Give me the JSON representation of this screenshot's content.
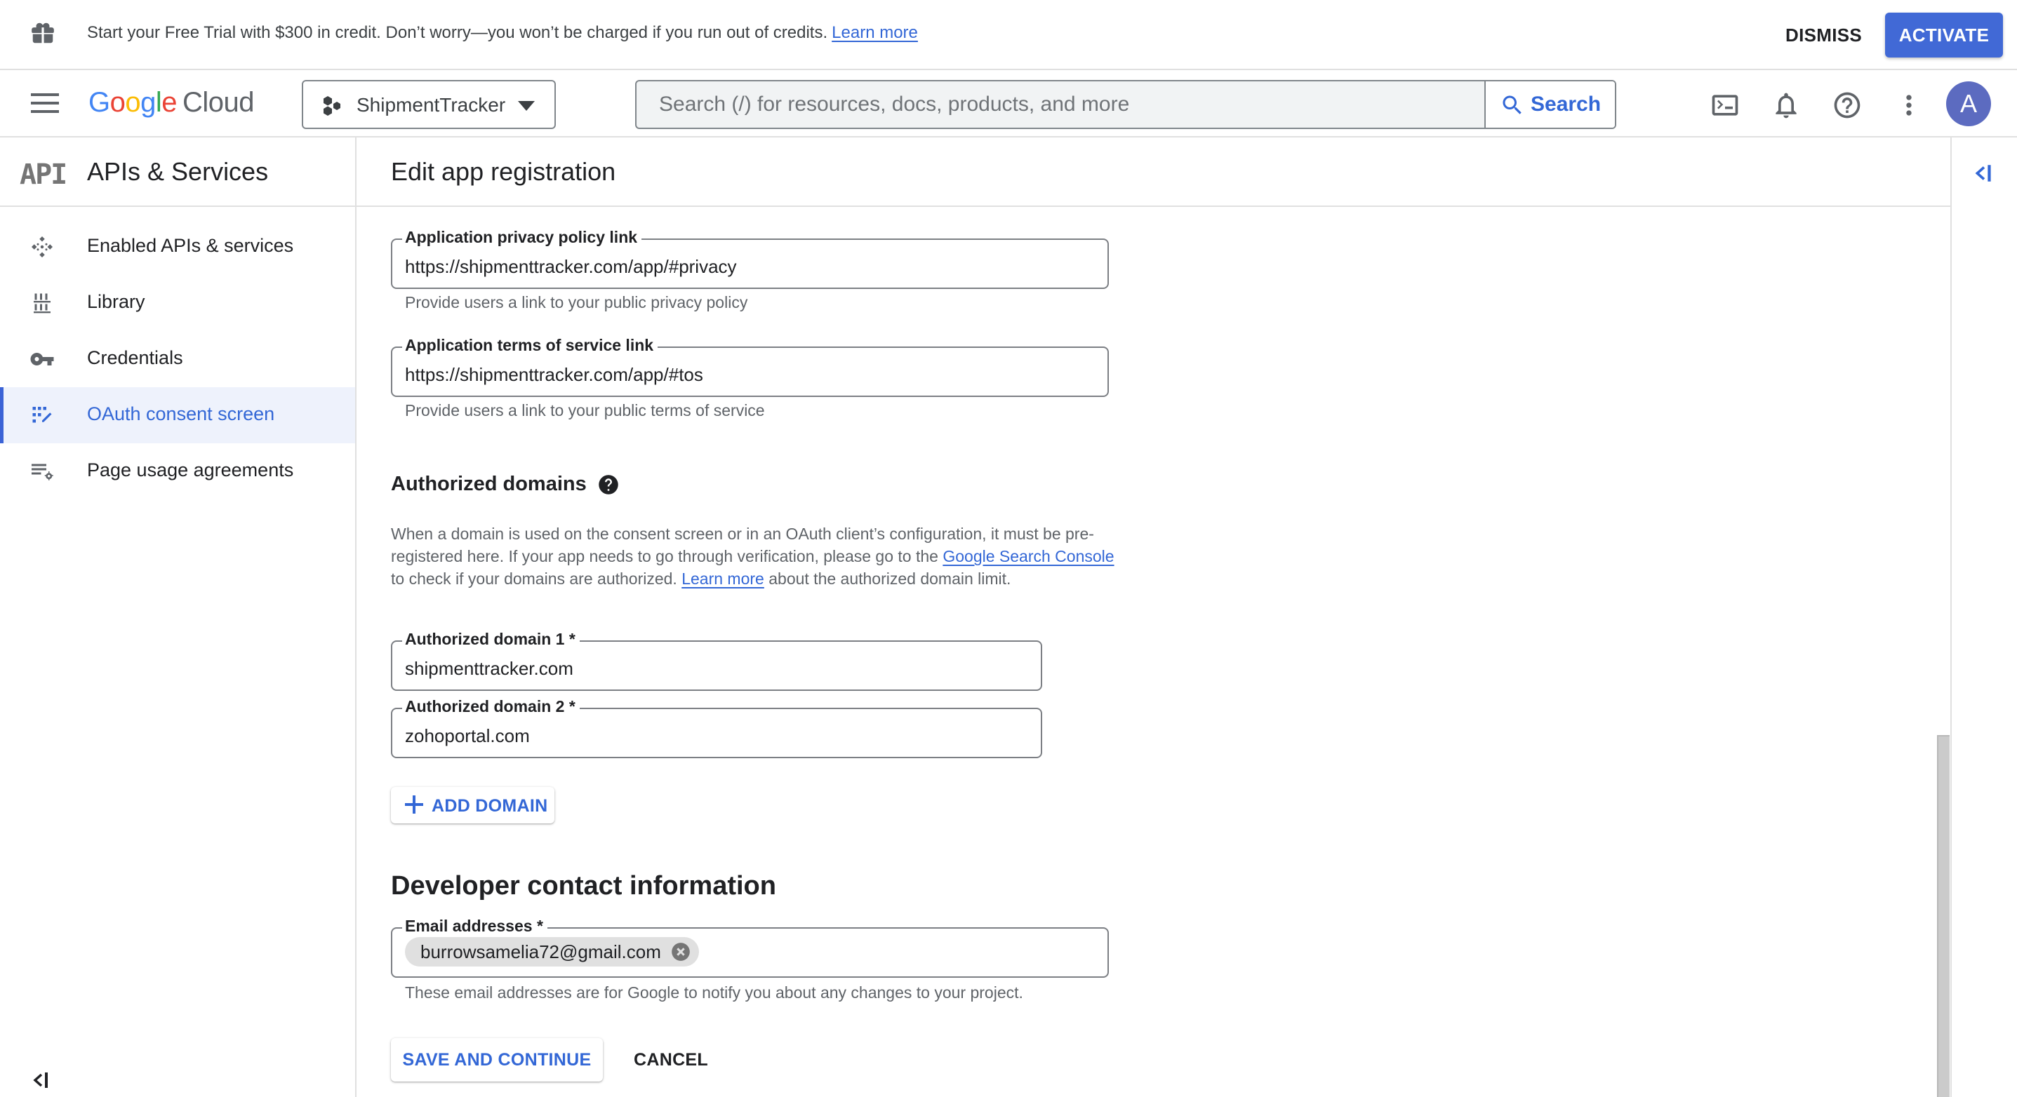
{
  "banner": {
    "message": "Start your Free Trial with $300 in credit. Don’t worry—you won’t be charged if you run out of credits.",
    "learn_more": "Learn more",
    "dismiss_label": "DISMISS",
    "activate_label": "ACTIVATE",
    "icon": "gift-icon"
  },
  "header": {
    "logo_google": [
      "G",
      "o",
      "o",
      "g",
      "l",
      "e"
    ],
    "logo_cloud": "Cloud",
    "project_name": "ShipmentTracker",
    "search_placeholder": "Search (/) for resources, docs, products, and more",
    "search_value": "",
    "search_button_label": "Search",
    "icons": [
      "cloud-shell-icon",
      "notifications-icon",
      "help-icon",
      "more-vert-icon"
    ],
    "avatar_letter": "A",
    "avatar_color": "#5c6bc0"
  },
  "sidebar": {
    "title": "APIs & Services",
    "title_icon_text": "API",
    "items": [
      {
        "label": "Enabled APIs & services",
        "icon": "enabled-apis-icon",
        "active": false
      },
      {
        "label": "Library",
        "icon": "library-icon",
        "active": false
      },
      {
        "label": "Credentials",
        "icon": "key-icon",
        "active": false
      },
      {
        "label": "OAuth consent screen",
        "icon": "oauth-consent-icon",
        "active": true
      },
      {
        "label": "Page usage agreements",
        "icon": "page-usage-settings-icon",
        "active": false
      }
    ],
    "collapse_icon": "collapse-left-icon"
  },
  "main": {
    "page_title": "Edit app registration",
    "privacy_field": {
      "label": "Application privacy policy link",
      "value": "https://shipmenttracker.com/app/#privacy",
      "hint": "Provide users a link to your public privacy policy"
    },
    "tos_field": {
      "label": "Application terms of service link",
      "value": "https://shipmenttracker.com/app/#tos",
      "hint": "Provide users a link to your public terms of service"
    },
    "authorized_domains": {
      "heading": "Authorized domains",
      "desc_1": "When a domain is used on the consent screen or in an OAuth client’s configuration, it must be pre-registered here. If your app needs to go through verification, please go to the ",
      "link_console": "Google Search Console",
      "desc_2": " to check if your domains are authorized. ",
      "link_learn": "Learn more",
      "desc_3": " about the authorized domain limit.",
      "domains": [
        {
          "label": "Authorized domain 1 *",
          "value": "shipmenttracker.com"
        },
        {
          "label": "Authorized domain 2 *",
          "value": "zohoportal.com"
        }
      ],
      "add_button_label": "ADD DOMAIN"
    },
    "developer_contact": {
      "heading": "Developer contact information",
      "email_label": "Email addresses *",
      "emails": [
        "burrowsamelia72@gmail.com"
      ],
      "hint": "These email addresses are for Google to notify you about any changes to your project."
    },
    "save_label": "SAVE AND CONTINUE",
    "cancel_label": "CANCEL"
  },
  "right_panel": {
    "expand_icon": "expand-panel-icon"
  },
  "colors": {
    "accent": "#3367d6",
    "activate_bg": "#4169d6",
    "active_nav_bg": "#eef2fc"
  }
}
